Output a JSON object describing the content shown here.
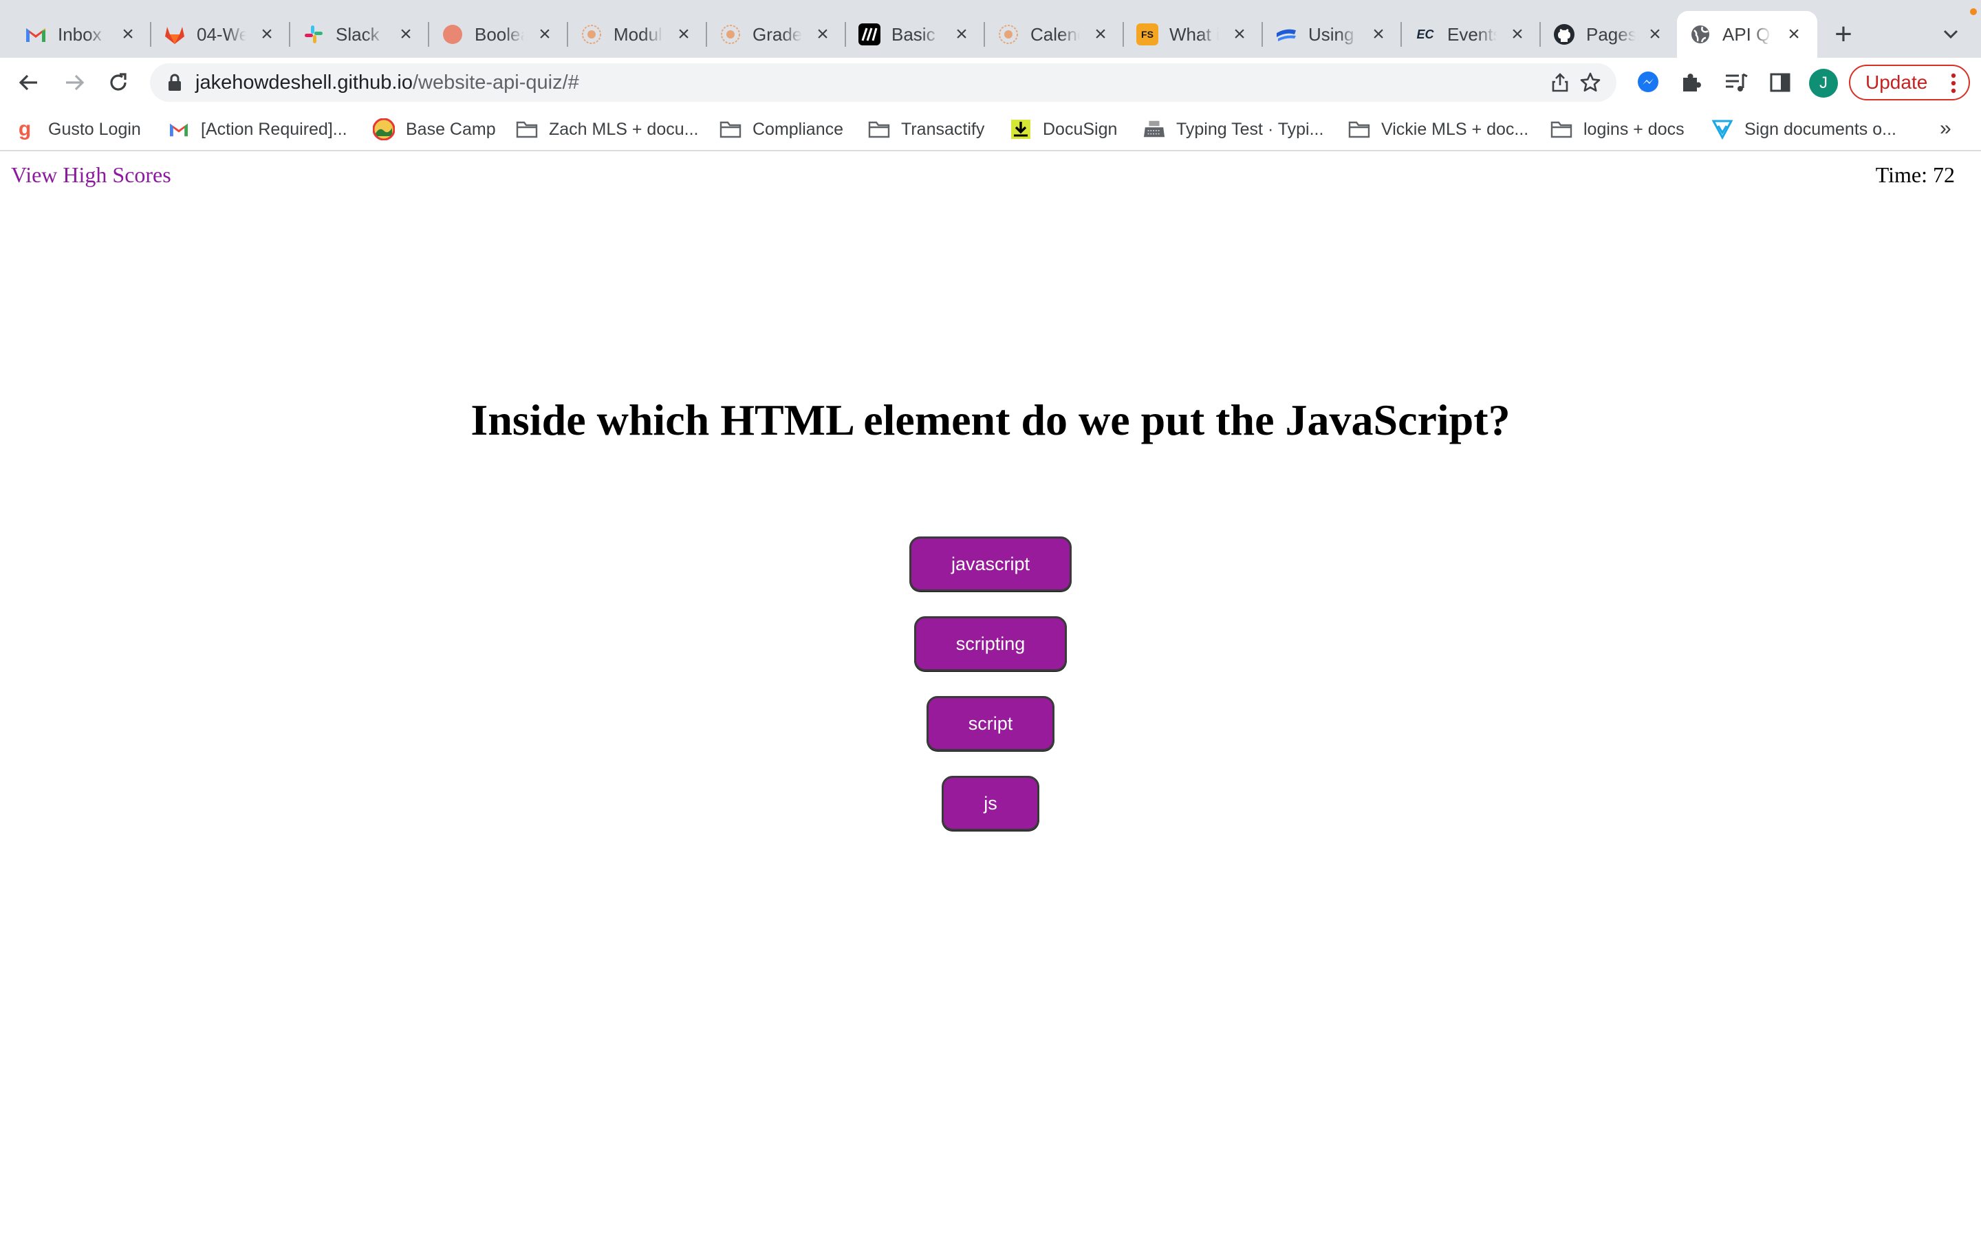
{
  "browser": {
    "tabs": [
      {
        "title": "Inbox (",
        "icon": "gmail-icon",
        "color": "#ea4335"
      },
      {
        "title": "04-We",
        "icon": "gitlab-icon",
        "color": "#e24329"
      },
      {
        "title": "Slack",
        "icon": "slack-icon",
        "color": "#4a154b"
      },
      {
        "title": "Boolea",
        "icon": "circle-icon",
        "color": "#e88873"
      },
      {
        "title": "Modul",
        "icon": "badge-icon",
        "color": "#e7a67a"
      },
      {
        "title": "Grade",
        "icon": "badge-icon",
        "color": "#e7a67a"
      },
      {
        "title": "Basic c",
        "icon": "mdn-icon",
        "color": "#000000"
      },
      {
        "title": "Calend",
        "icon": "badge-icon",
        "color": "#e7a67a"
      },
      {
        "title": "What i",
        "icon": "fs-icon",
        "color": "#f4a623"
      },
      {
        "title": "Using",
        "icon": "wave-icon",
        "color": "#1f5bd6"
      },
      {
        "title": "Events",
        "icon": "ec-icon",
        "color": "#1a2a3a"
      },
      {
        "title": "Pages",
        "icon": "github-icon",
        "color": "#24292f"
      },
      {
        "title": "API Qu",
        "icon": "globe-icon",
        "color": "#5f6368",
        "active": true
      }
    ],
    "url_host": "jakehowdeshell.github.io",
    "url_path": "/website-api-quiz/#",
    "profile_initial": "J",
    "update_label": "Update",
    "bookmarks": [
      {
        "label": "Gusto Login",
        "icon": "gusto-icon"
      },
      {
        "label": "[Action Required]...",
        "icon": "gmail-icon"
      },
      {
        "label": "Base Camp",
        "icon": "basecamp-icon"
      },
      {
        "label": "Zach MLS + docu...",
        "icon": "folder-icon"
      },
      {
        "label": "Compliance",
        "icon": "folder-icon"
      },
      {
        "label": "Transactify",
        "icon": "folder-icon"
      },
      {
        "label": "DocuSign",
        "icon": "docusign-icon"
      },
      {
        "label": "Typing Test · Typi...",
        "icon": "typewriter-icon"
      },
      {
        "label": "Vickie MLS + doc...",
        "icon": "folder-icon"
      },
      {
        "label": "logins + docs",
        "icon": "folder-icon"
      },
      {
        "label": "Sign documents o...",
        "icon": "sign-icon"
      }
    ],
    "bookmarks_more": "»"
  },
  "quiz": {
    "high_scores_link": "View High Scores",
    "timer": "Time: 72",
    "question": "Inside which HTML element do we put the JavaScript?",
    "answers": [
      "javascript",
      "scripting",
      "script",
      "js"
    ]
  },
  "colors": {
    "accent": "#971b9a",
    "link": "#8b1a9e",
    "update": "#c5221f"
  }
}
